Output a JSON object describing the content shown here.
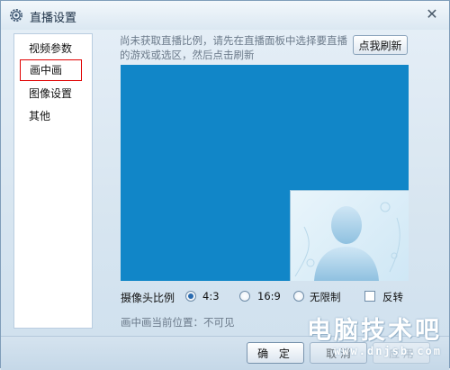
{
  "window": {
    "title": "直播设置",
    "title_icon": "gear-icon",
    "close_icon": "close-icon",
    "close_symbol": "✕"
  },
  "sidebar": {
    "items": [
      {
        "label": "视频参数",
        "selected": false
      },
      {
        "label": "画中画",
        "selected": true
      },
      {
        "label": "图像设置",
        "selected": false
      },
      {
        "label": "其他",
        "selected": false
      }
    ]
  },
  "main": {
    "notice": "尚未获取直播比例，请先在直播面板中选择要直播的游戏或选区，然后点击刷新",
    "refresh_button": "点我刷新",
    "preview_color": "#1186c8",
    "camera_ratio": {
      "label": "摄像头比例",
      "options": [
        {
          "label": "4:3",
          "checked": true
        },
        {
          "label": "16:9",
          "checked": false
        },
        {
          "label": "无限制",
          "checked": false
        }
      ],
      "flip_label": "反转",
      "flip_checked": false
    },
    "pip_position_text": "画中画当前位置：不可见"
  },
  "footer": {
    "ok_label": "确 定",
    "cancel_label": "取 消",
    "apply_label": "应 用"
  },
  "watermark": {
    "cn": "电脑技术吧",
    "url": "www.dnjsb.com"
  }
}
